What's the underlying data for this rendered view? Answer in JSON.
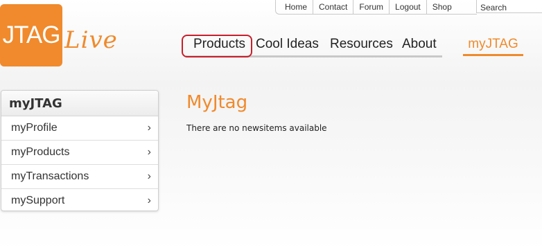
{
  "logo": {
    "text": "JTAG",
    "tagline": "Live"
  },
  "top_links": [
    "Home",
    "Contact",
    "Forum",
    "Logout",
    "Shop"
  ],
  "search": {
    "placeholder": "Search"
  },
  "main_nav": {
    "products": "Products",
    "cool_ideas": "Cool Ideas",
    "resources": "Resources",
    "about": "About",
    "myjtag": "myJTAG"
  },
  "sidebar": {
    "title": "myJTAG",
    "items": [
      {
        "label": "myProfile",
        "chevron": "›"
      },
      {
        "label": "myProducts",
        "chevron": "›"
      },
      {
        "label": "myTransactions",
        "chevron": "›"
      },
      {
        "label": "mySupport",
        "chevron": "›"
      }
    ]
  },
  "content": {
    "title": "MyJtag",
    "message": "There are no newsitems available"
  },
  "colors": {
    "accent": "#f08a2c",
    "highlight": "#c81e2a",
    "nav_underline": "#c8c8c8"
  },
  "icons": {
    "sidebar_chevron": "chevron-right-icon"
  }
}
